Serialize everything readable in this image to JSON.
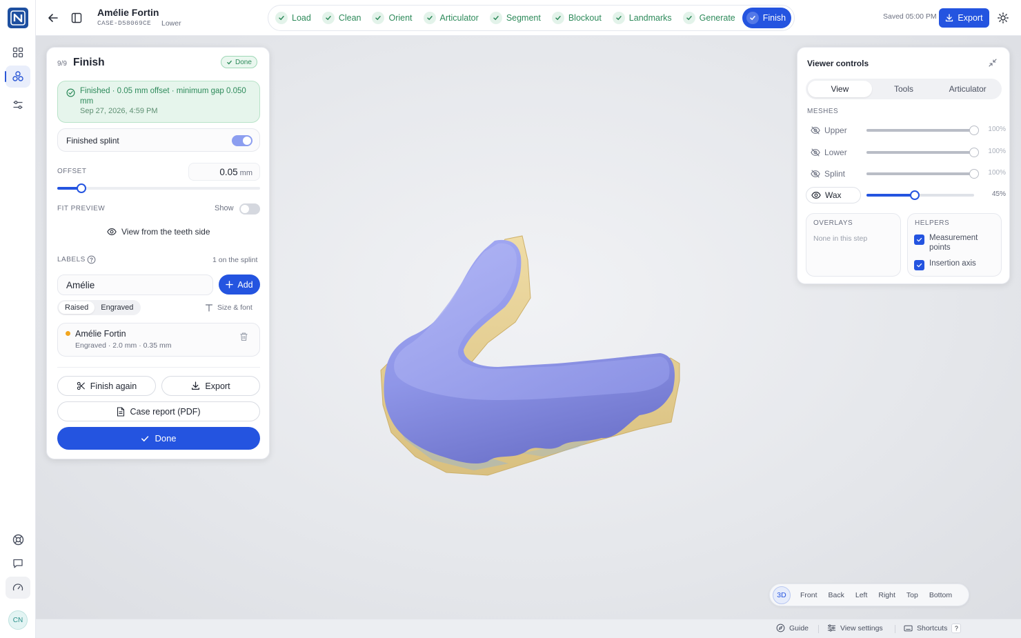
{
  "header": {
    "case_name": "Amélie Fortin",
    "case_id": "CASE-D58069CE",
    "jaw": "Lower",
    "steps": [
      {
        "label": "Load"
      },
      {
        "label": "Clean"
      },
      {
        "label": "Orient"
      },
      {
        "label": "Articulator"
      },
      {
        "label": "Segment"
      },
      {
        "label": "Blockout"
      },
      {
        "label": "Landmarks"
      },
      {
        "label": "Generate"
      },
      {
        "label": "Finish",
        "active": true
      }
    ],
    "saved": "Saved 05:00 PM",
    "export_label": "Export"
  },
  "rail": {
    "avatar": "CN"
  },
  "panel": {
    "step_count": "9/9",
    "title": "Finish",
    "badge": "Done",
    "status_text": "Finished · 0.05 mm offset · minimum gap 0.050 mm",
    "status_date": "Sep 27, 2026, 4:59 PM",
    "finished_splint_label": "Finished splint",
    "finished_splint_on": true,
    "offset_label": "OFFSET",
    "offset_value": "0.05",
    "offset_unit": "mm",
    "offset_slider": 0.12,
    "fit_preview_label": "FIT PREVIEW",
    "fit_preview_toggle_label": "Show",
    "fit_preview_on": false,
    "teeth_side_label": "View from the teeth side",
    "labels_label": "LABELS",
    "labels_count": "1 on the splint",
    "label_input_value": "Amélie",
    "add_label": "Add",
    "style_options": [
      "Raised",
      "Engraved"
    ],
    "style_selected": "Engraved",
    "size_font_label": "Size & font",
    "label_card": {
      "name": "Amélie Fortin",
      "meta": "Engraved · 2.0 mm · 0.35 mm"
    },
    "finish_again_label": "Finish again",
    "export_label": "Export",
    "case_report_label": "Case report (PDF)",
    "done_label": "Done"
  },
  "viewer": {
    "title": "Viewer controls",
    "tabs": [
      "View",
      "Tools",
      "Articulator"
    ],
    "selected_tab": "View",
    "meshes_label": "MESHES",
    "meshes": [
      {
        "name": "Upper",
        "percent": "100%",
        "value": 1.0,
        "visible": false
      },
      {
        "name": "Lower",
        "percent": "100%",
        "value": 1.0,
        "visible": false
      },
      {
        "name": "Splint",
        "percent": "100%",
        "value": 1.0,
        "visible": false
      },
      {
        "name": "Wax",
        "percent": "45%",
        "value": 0.45,
        "visible": true
      }
    ],
    "overlays_label": "OVERLAYS",
    "overlays_text": "None in this step",
    "helpers_label": "HELPERS",
    "helpers": [
      {
        "label": "Measurement points",
        "checked": true
      },
      {
        "label": "Insertion axis",
        "checked": true
      }
    ]
  },
  "view_presets": [
    "3D",
    "Front",
    "Back",
    "Left",
    "Right",
    "Top",
    "Bottom"
  ],
  "view_preset_selected": "3D",
  "statusbar": {
    "guide": "Guide",
    "view_settings": "View settings",
    "shortcuts": "Shortcuts",
    "shortcut_key": "?"
  },
  "colors": {
    "accent": "#2454e0",
    "success": "#2d8a5a",
    "splint": "#8f96e6",
    "model": "#e8d49a"
  }
}
